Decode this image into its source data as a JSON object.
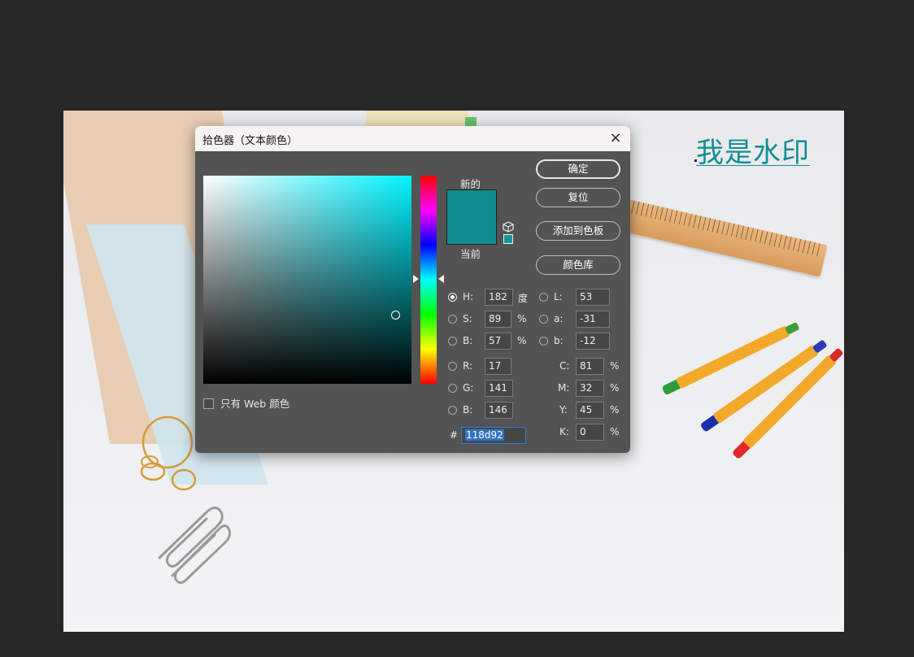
{
  "canvas": {
    "watermark_text": "我是水印",
    "watermark_color": "#118d92"
  },
  "dialog": {
    "title": "拾色器（文本颜色）",
    "close_icon": "×",
    "swatch_label_new": "新的",
    "swatch_label_current": "当前",
    "new_color": "#118d92",
    "current_color": "#118d92",
    "web_only_label": "只有 Web 颜色",
    "web_only_checked": false,
    "buttons": {
      "ok": "确定",
      "reset": "复位",
      "add_to_swatches": "添加到色板",
      "color_libraries": "颜色库"
    },
    "hsb": {
      "h_label": "H:",
      "h_value": "182",
      "h_unit": "度",
      "s_label": "S:",
      "s_value": "89",
      "s_unit": "%",
      "b_label": "B:",
      "b_value": "57",
      "b_unit": "%",
      "selected": "H"
    },
    "lab": {
      "l_label": "L:",
      "l_value": "53",
      "a_label": "a:",
      "a_value": "-31",
      "b_label": "b:",
      "b_value": "-12"
    },
    "rgb": {
      "r_label": "R:",
      "r_value": "17",
      "g_label": "G:",
      "g_value": "141",
      "b_label": "B:",
      "b_value": "146"
    },
    "cmyk": {
      "c_label": "C:",
      "c_value": "81",
      "m_label": "M:",
      "m_value": "32",
      "y_label": "Y:",
      "y_value": "45",
      "k_label": "K:",
      "k_value": "0",
      "unit": "%"
    },
    "hex_label": "#",
    "hex_value": "118d92"
  }
}
